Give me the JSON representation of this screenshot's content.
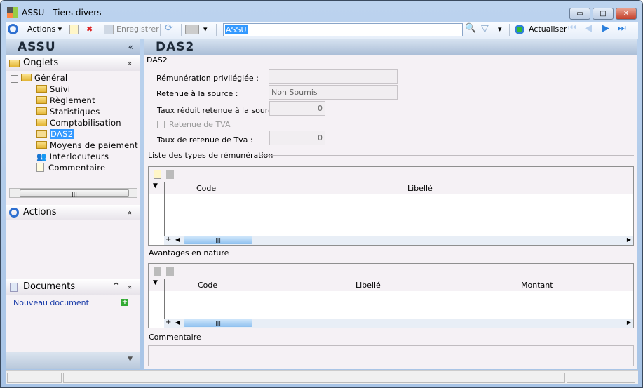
{
  "window": {
    "title": "ASSU -  Tiers divers",
    "min": "▭",
    "max": "□",
    "close": "✕"
  },
  "toolbar": {
    "actions": "Actions",
    "save": "Enregistrer",
    "search_value": "ASSU",
    "refresh": "Actualiser"
  },
  "left": {
    "header": "ASSU",
    "collapse": "«",
    "onglets": "Onglets",
    "tree": [
      {
        "label": "Général"
      },
      {
        "label": "Suivi"
      },
      {
        "label": "Règlement"
      },
      {
        "label": "Statistiques"
      },
      {
        "label": "Comptabilisation"
      },
      {
        "label": "DAS2"
      },
      {
        "label": "Moyens de paiement"
      },
      {
        "label": "Interlocuteurs"
      },
      {
        "label": "Commentaire"
      }
    ],
    "actions": "Actions",
    "documents": "Documents",
    "new_doc": "Nouveau document",
    "up": "⌃",
    "chev": "»"
  },
  "main": {
    "header": "DAS2",
    "group": "DAS2",
    "fields": {
      "remun_label": "Rémunération privilégiée :",
      "remun_value": "",
      "retenue_label": "Retenue à la source :",
      "retenue_value": "Non Soumis",
      "taux_reduit_label": "Taux réduit retenue à la source :",
      "taux_reduit_value": "0",
      "tva_check": "Retenue de TVA",
      "taux_tva_label": "Taux de retenue de Tva :",
      "taux_tva_value": "0"
    },
    "grid1": {
      "title": "Liste des types de rémunération",
      "columns": [
        "Code",
        "Libellé"
      ]
    },
    "grid2": {
      "title": "Avantages en nature",
      "columns": [
        "Code",
        "Libellé",
        "Montant"
      ]
    },
    "comment_title": "Commentaire"
  }
}
